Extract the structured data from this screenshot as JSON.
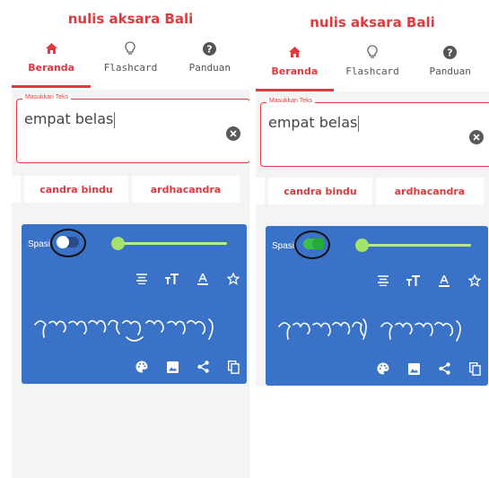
{
  "panels": [
    {
      "app_title": "nulis aksara Bali",
      "tabs": [
        {
          "label": "Beranda",
          "icon": "home-icon",
          "active": true
        },
        {
          "label": "Flashcard",
          "icon": "lightbulb-icon",
          "active": false
        },
        {
          "label": "Panduan",
          "icon": "help-icon",
          "active": false
        }
      ],
      "input": {
        "legend": "Masukkan Teks",
        "value": "empat belas"
      },
      "chips": [
        "candra bindu",
        "ardhacandra"
      ],
      "card": {
        "spasi_label": "Spasi",
        "spasi_on": false
      }
    },
    {
      "app_title": "nulis aksara Bali",
      "tabs": [
        {
          "label": "Beranda",
          "icon": "home-icon",
          "active": true
        },
        {
          "label": "Flashcard",
          "icon": "lightbulb-icon",
          "active": false
        },
        {
          "label": "Panduan",
          "icon": "help-icon",
          "active": false
        }
      ],
      "input": {
        "legend": "Masukkan Teks",
        "value": "empat belas"
      },
      "chips": [
        "candra bindu",
        "ardhacandra"
      ],
      "card": {
        "spasi_label": "Spasi",
        "spasi_on": true
      }
    }
  ],
  "colors": {
    "accent": "#e0393e",
    "card": "#3a72c8",
    "toggle_on": "#3cc04a"
  }
}
